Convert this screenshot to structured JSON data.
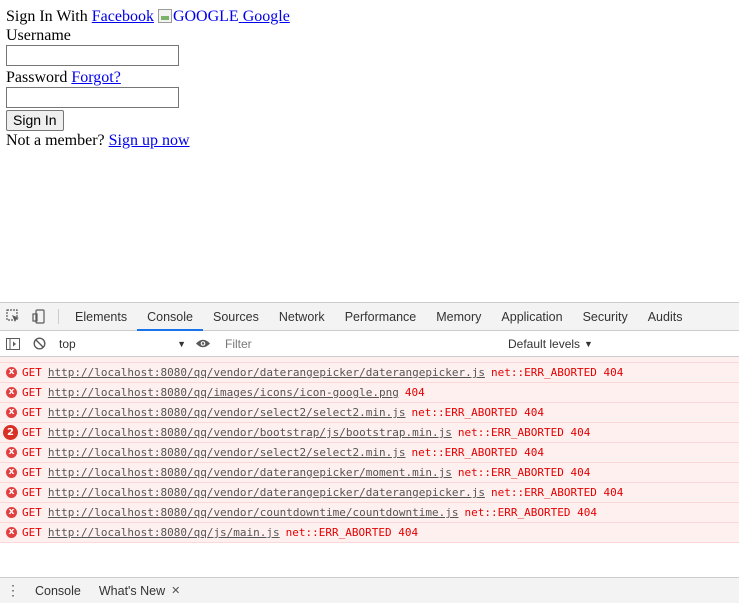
{
  "page": {
    "signin_with": "Sign In With",
    "facebook_link": "Facebook",
    "google_img_alt": "GOOGLE",
    "google_link": "Google",
    "username_label": "Username",
    "password_label": "Password",
    "forgot_link": "Forgot?",
    "signin_button": "Sign In",
    "not_member": "Not a member?",
    "signup_link": "Sign up now"
  },
  "devtools": {
    "tabs": [
      "Elements",
      "Console",
      "Sources",
      "Network",
      "Performance",
      "Memory",
      "Application",
      "Security",
      "Audits"
    ],
    "active_tab": "Console",
    "context": "top",
    "filter_placeholder": "Filter",
    "levels": "Default levels",
    "messages": [
      {
        "method": "GET",
        "url": "http://localhost:8080/qq/vendor/daterangepicker/daterangepicker.js",
        "status": "net::ERR_ABORTED 404"
      },
      {
        "method": "GET",
        "url": "http://localhost:8080/qq/images/icons/icon-google.png",
        "status": "404"
      },
      {
        "method": "GET",
        "url": "http://localhost:8080/qq/vendor/select2/select2.min.js",
        "status": "net::ERR_ABORTED 404"
      },
      {
        "method": "GET",
        "url": "http://localhost:8080/qq/vendor/bootstrap/js/bootstrap.min.js",
        "status": "net::ERR_ABORTED 404",
        "count": "2"
      },
      {
        "method": "GET",
        "url": "http://localhost:8080/qq/vendor/select2/select2.min.js",
        "status": "net::ERR_ABORTED 404"
      },
      {
        "method": "GET",
        "url": "http://localhost:8080/qq/vendor/daterangepicker/moment.min.js",
        "status": "net::ERR_ABORTED 404"
      },
      {
        "method": "GET",
        "url": "http://localhost:8080/qq/vendor/daterangepicker/daterangepicker.js",
        "status": "net::ERR_ABORTED 404"
      },
      {
        "method": "GET",
        "url": "http://localhost:8080/qq/vendor/countdowntime/countdowntime.js",
        "status": "net::ERR_ABORTED 404"
      },
      {
        "method": "GET",
        "url": "http://localhost:8080/qq/js/main.js",
        "status": "net::ERR_ABORTED 404"
      }
    ],
    "drawer_tabs": [
      "Console",
      "What's New"
    ],
    "error_icon": "x",
    "accent_color": "#1a73e8",
    "error_color": "#e60000"
  }
}
